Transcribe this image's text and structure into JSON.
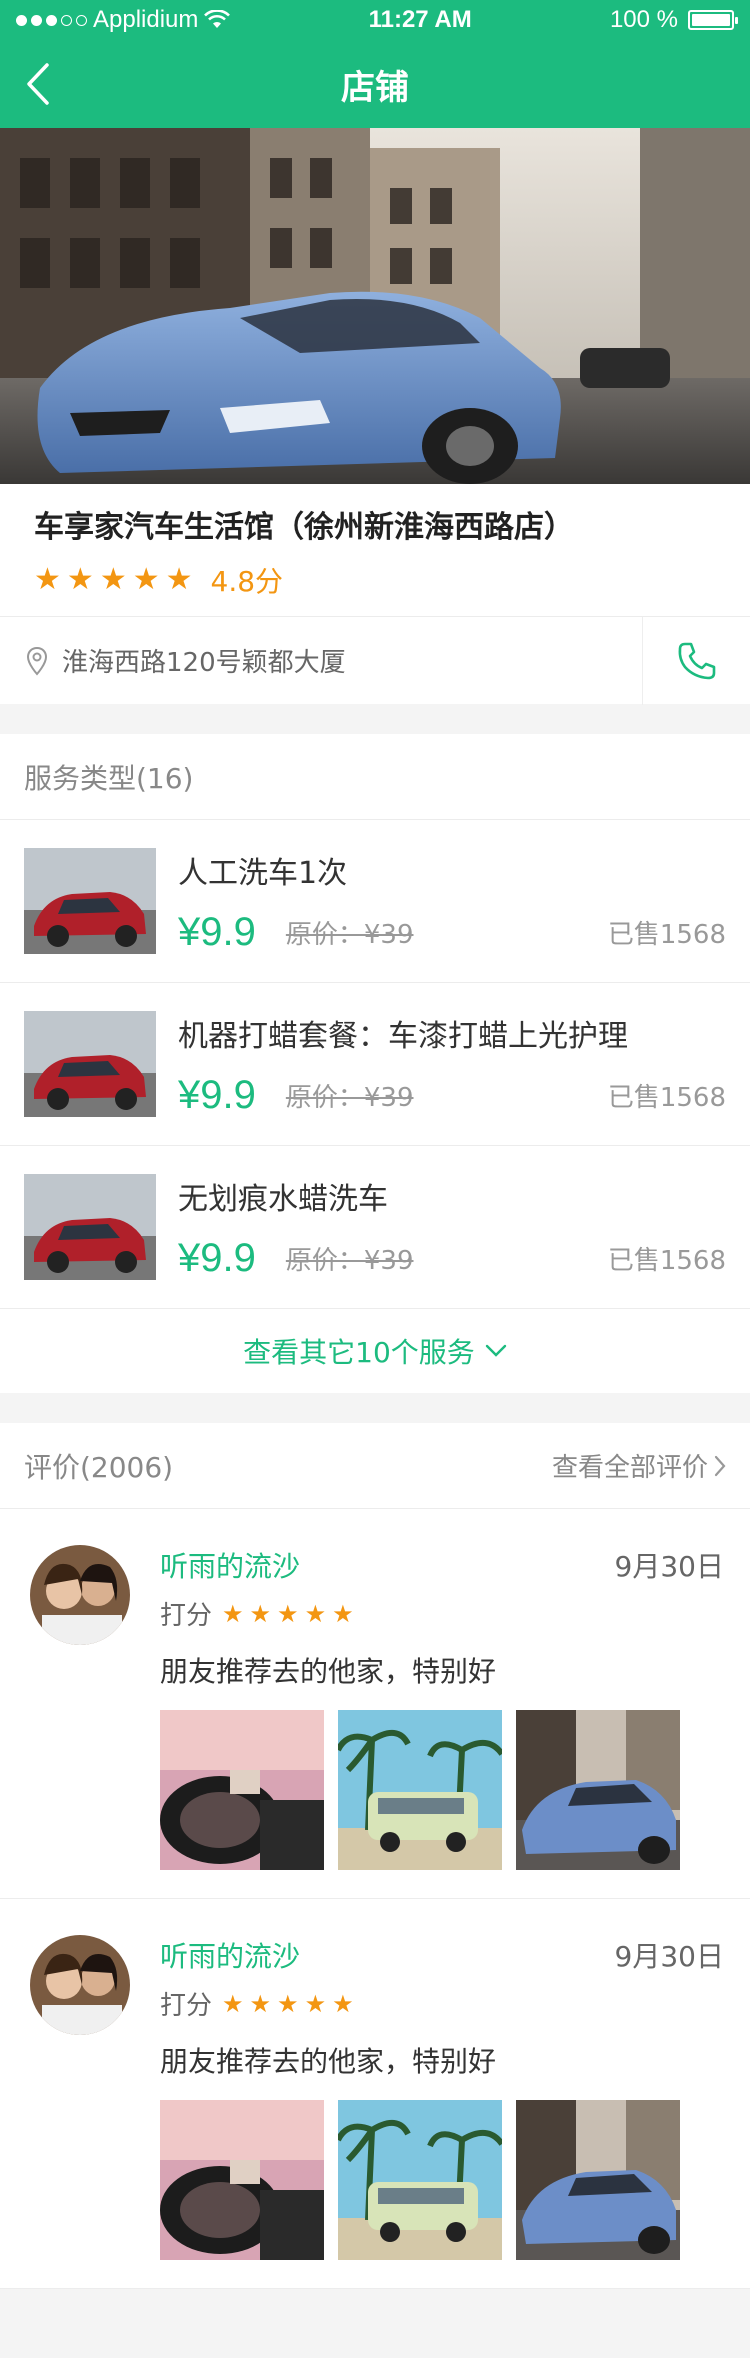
{
  "status_bar": {
    "carrier": "Applidium",
    "time": "11:27 AM",
    "battery": "100 %"
  },
  "nav": {
    "title": "店铺"
  },
  "store": {
    "name": "车享家汽车生活馆（徐州新淮海西路店）",
    "rating_stars": 5,
    "rating_text": "4.8分",
    "address": "淮海西路120号颖都大厦"
  },
  "services": {
    "header": "服务类型(16)",
    "items": [
      {
        "name": "人工洗车1次",
        "price": "¥9.9",
        "original": "原价：¥39",
        "sold": "已售1568"
      },
      {
        "name": "机器打蜡套餐：车漆打蜡上光护理",
        "price": "¥9.9",
        "original": "原价：¥39",
        "sold": "已售1568"
      },
      {
        "name": "无划痕水蜡洗车",
        "price": "¥9.9",
        "original": "原价：¥39",
        "sold": "已售1568"
      }
    ],
    "more": "查看其它10个服务"
  },
  "reviews": {
    "header": "评价(2006)",
    "view_all": "查看全部评价",
    "items": [
      {
        "user": "听雨的流沙",
        "date": "9月30日",
        "score_label": "打分",
        "stars": 5,
        "text": "朋友推荐去的他家，特别好"
      },
      {
        "user": "听雨的流沙",
        "date": "9月30日",
        "score_label": "打分",
        "stars": 5,
        "text": "朋友推荐去的他家，特别好"
      }
    ]
  },
  "colors": {
    "brand": "#1cbb7f",
    "star": "#f39612"
  }
}
